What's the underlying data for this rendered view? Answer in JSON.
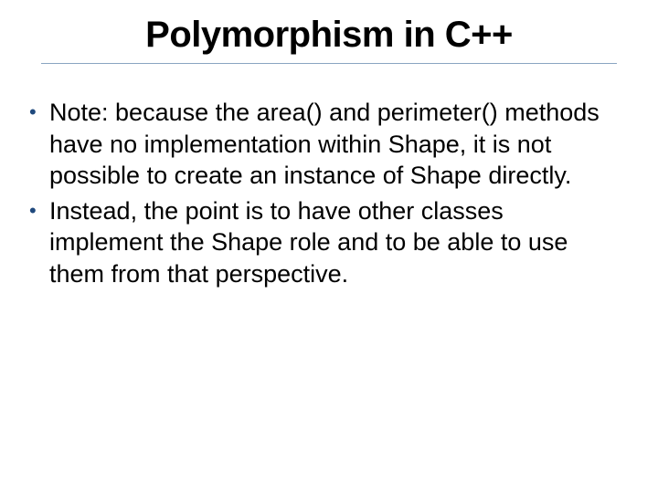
{
  "title": "Polymorphism in C++",
  "bullets": [
    "Note:  because the area() and perimeter() methods have no implementation within Shape, it is not possible to create an instance of Shape directly.",
    "Instead, the point is to have other classes implement the Shape role and to be able to use them from that perspective."
  ]
}
